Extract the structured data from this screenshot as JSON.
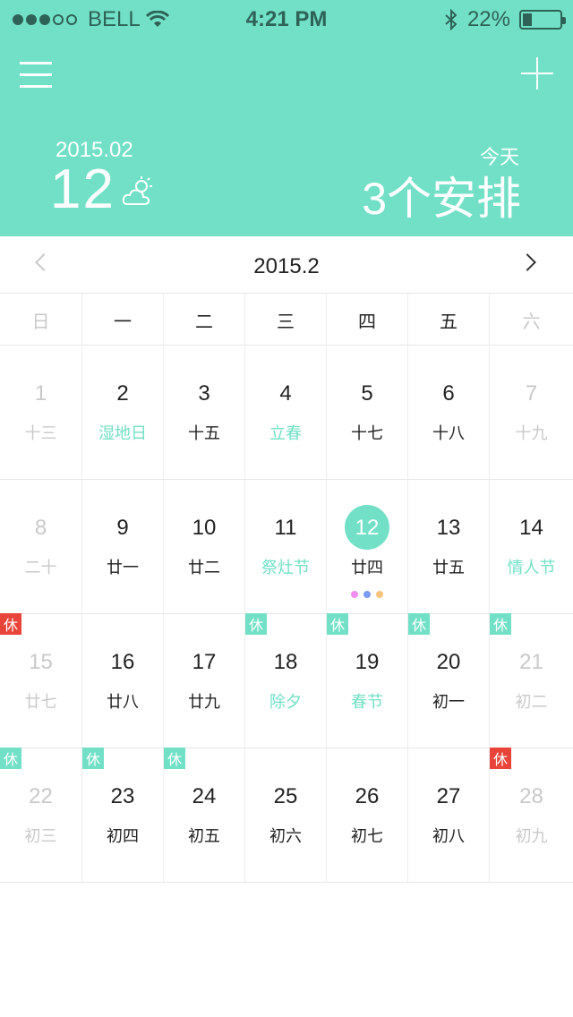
{
  "status_bar": {
    "carrier": "BELL",
    "time": "4:21 PM",
    "battery": "22%",
    "battery_level": 0.22,
    "signal_icon": "signal-dots-icon",
    "wifi_icon": "wifi-icon",
    "bluetooth_icon": "bluetooth-icon"
  },
  "header": {
    "date_label": "2015.02",
    "day": "12",
    "weather_icon": "partly-cloudy-icon",
    "today_label": "今天",
    "events_summary": "3个安排",
    "accent_color": "#72e0c6"
  },
  "calendar": {
    "month_title": "2015.2",
    "weekdays": [
      "日",
      "一",
      "二",
      "三",
      "四",
      "五",
      "六"
    ],
    "weeks": [
      [
        {
          "day": "1",
          "lunar": "十三",
          "muted": true
        },
        {
          "day": "2",
          "lunar": "湿地日",
          "fest": true
        },
        {
          "day": "3",
          "lunar": "十五"
        },
        {
          "day": "4",
          "lunar": "立春",
          "fest": true
        },
        {
          "day": "5",
          "lunar": "十七"
        },
        {
          "day": "6",
          "lunar": "十八"
        },
        {
          "day": "7",
          "lunar": "十九",
          "muted": true
        }
      ],
      [
        {
          "day": "8",
          "lunar": "二十",
          "muted": true
        },
        {
          "day": "9",
          "lunar": "廿一"
        },
        {
          "day": "10",
          "lunar": "廿二"
        },
        {
          "day": "11",
          "lunar": "祭灶节",
          "fest": true
        },
        {
          "day": "12",
          "lunar": "廿四",
          "today": true,
          "events": [
            "#f28ef0",
            "#7c9bf2",
            "#f7c47d"
          ]
        },
        {
          "day": "13",
          "lunar": "廿五"
        },
        {
          "day": "14",
          "lunar": "情人节",
          "fest": true
        }
      ],
      [
        {
          "day": "15",
          "lunar": "廿七",
          "muted": true,
          "tag": "休",
          "tag_color": "#e8443a"
        },
        {
          "day": "16",
          "lunar": "廿八"
        },
        {
          "day": "17",
          "lunar": "廿九"
        },
        {
          "day": "18",
          "lunar": "除夕",
          "fest": true,
          "tag": "休",
          "tag_color": "#72e0c6"
        },
        {
          "day": "19",
          "lunar": "春节",
          "fest": true,
          "tag": "休",
          "tag_color": "#72e0c6"
        },
        {
          "day": "20",
          "lunar": "初一",
          "tag": "休",
          "tag_color": "#72e0c6"
        },
        {
          "day": "21",
          "lunar": "初二",
          "muted": true,
          "tag": "休",
          "tag_color": "#72e0c6"
        }
      ],
      [
        {
          "day": "22",
          "lunar": "初三",
          "muted": true,
          "tag": "休",
          "tag_color": "#72e0c6"
        },
        {
          "day": "23",
          "lunar": "初四",
          "tag": "休",
          "tag_color": "#72e0c6"
        },
        {
          "day": "24",
          "lunar": "初五",
          "tag": "休",
          "tag_color": "#72e0c6"
        },
        {
          "day": "25",
          "lunar": "初六"
        },
        {
          "day": "26",
          "lunar": "初七"
        },
        {
          "day": "27",
          "lunar": "初八"
        },
        {
          "day": "28",
          "lunar": "初九",
          "muted": true,
          "tag": "休",
          "tag_color": "#e8443a"
        }
      ]
    ]
  }
}
